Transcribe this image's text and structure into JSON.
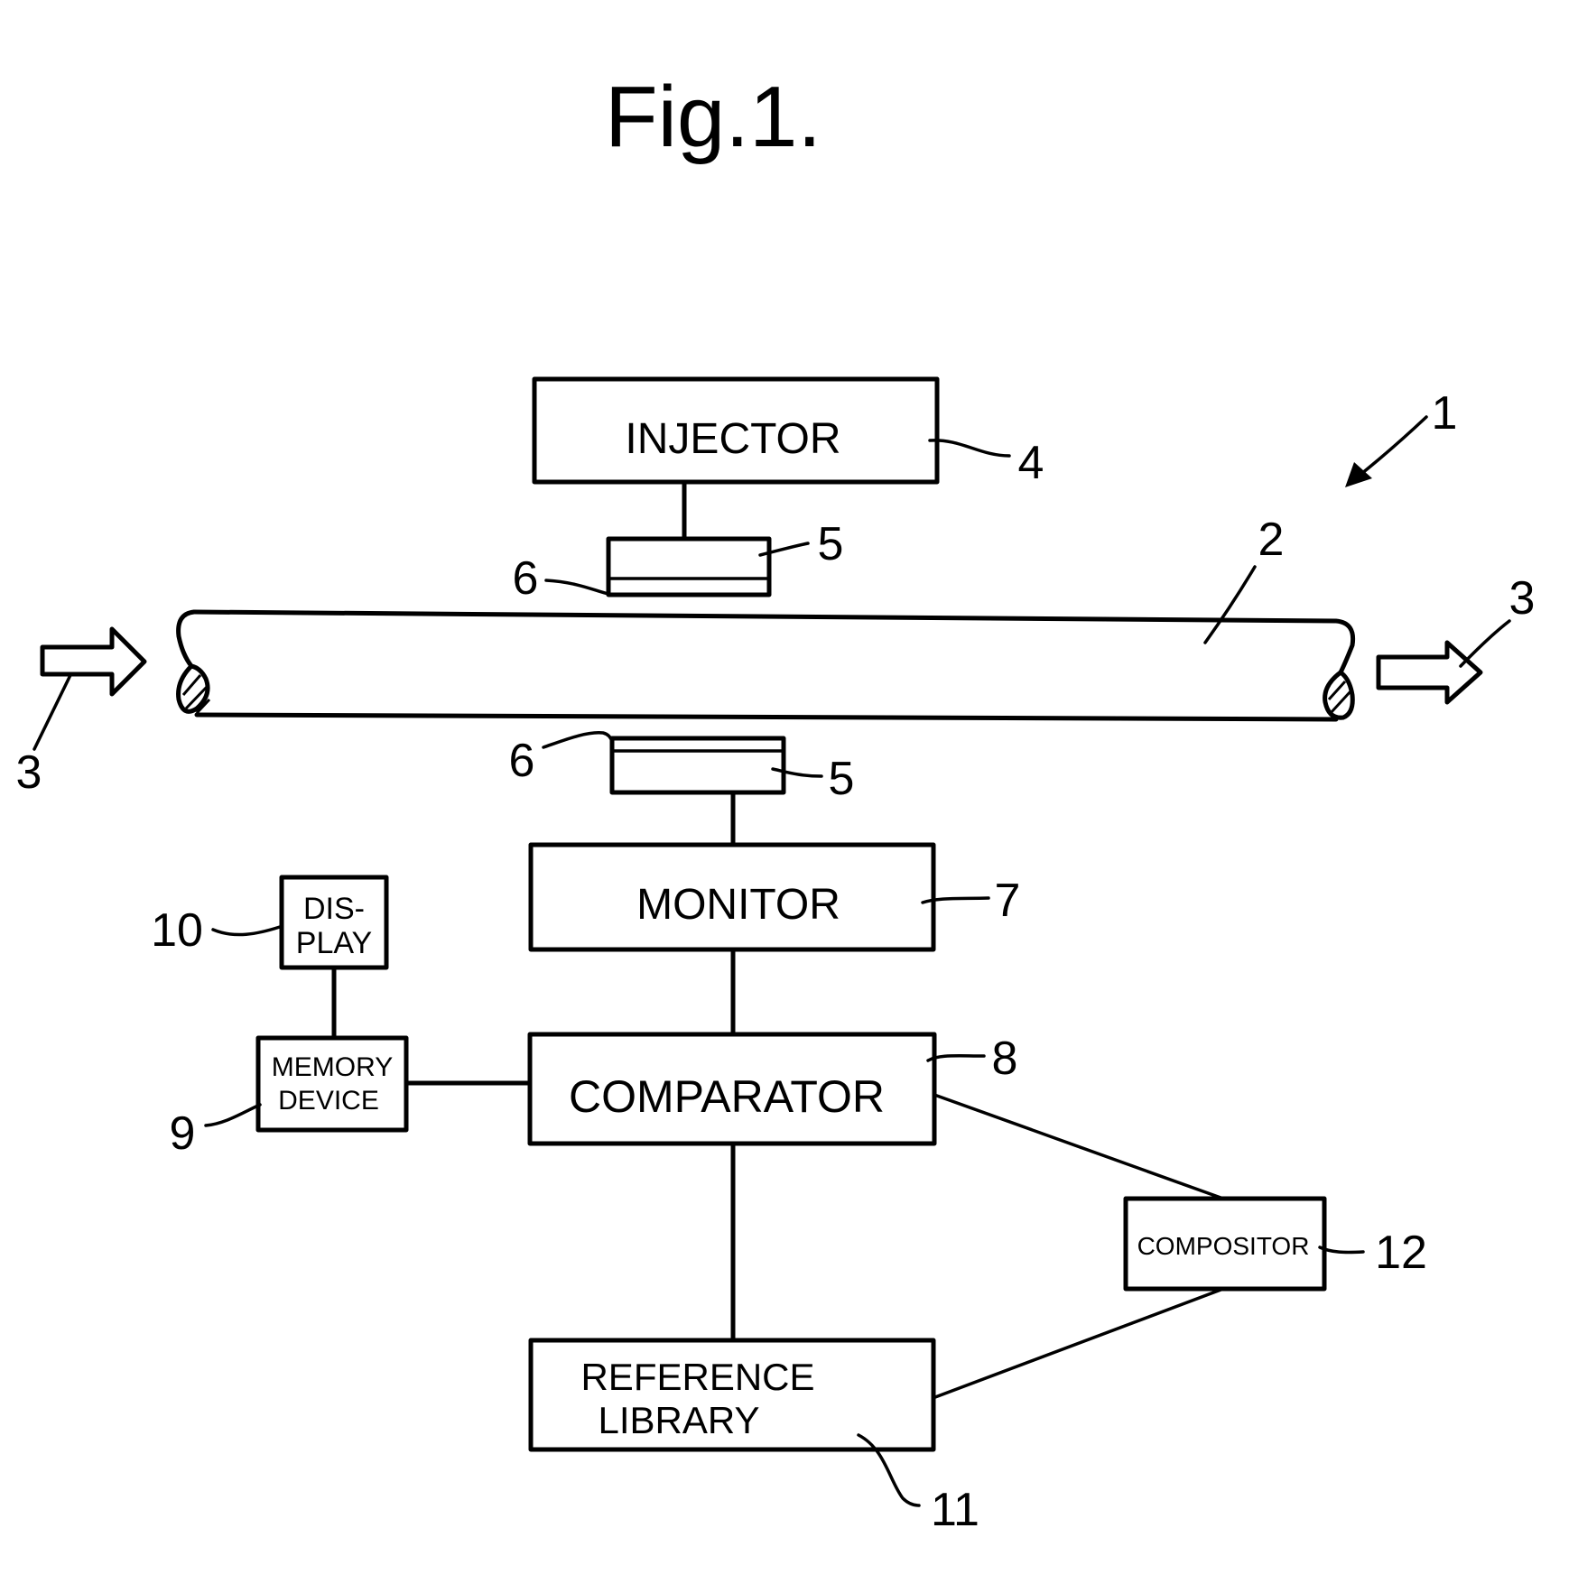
{
  "figure": {
    "title": "Fig.1."
  },
  "blocks": {
    "injector": {
      "label": "INJECTOR",
      "ref": "4"
    },
    "monitor": {
      "label": "MONITOR",
      "ref": "7"
    },
    "comparator": {
      "label": "COMPARATOR",
      "ref": "8"
    },
    "memory_device": {
      "line1": "MEMORY",
      "line2": "DEVICE",
      "ref": "9"
    },
    "display": {
      "line1": "DIS-",
      "line2": "PLAY",
      "ref": "10"
    },
    "reference_library": {
      "line1": "REFERENCE",
      "line2": "LIBRARY",
      "ref": "11"
    },
    "compositor": {
      "label": "COMPOSITOR",
      "ref": "12"
    }
  },
  "components": {
    "system_ref": "1",
    "pipe_ref": "2",
    "flow_in_ref": "3",
    "flow_out_ref": "3",
    "probe_top_ref": "5",
    "probe_top_layer_ref": "6",
    "probe_bottom_ref": "5",
    "probe_bottom_layer_ref": "6"
  },
  "connections": [
    [
      "injector",
      "probe_top"
    ],
    [
      "probe_bottom",
      "monitor"
    ],
    [
      "monitor",
      "comparator"
    ],
    [
      "comparator",
      "memory_device"
    ],
    [
      "memory_device",
      "display"
    ],
    [
      "comparator",
      "reference_library"
    ],
    [
      "comparator",
      "compositor"
    ],
    [
      "compositor",
      "reference_library"
    ]
  ]
}
